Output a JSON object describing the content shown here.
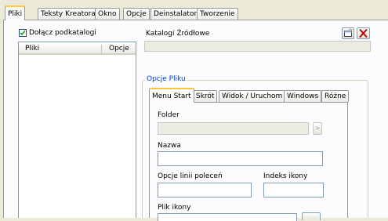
{
  "tabs": [
    "Pliki",
    "Teksty Kreatora",
    "Okno",
    "Opcje",
    "Deinstalator",
    "Tworzenie"
  ],
  "include_subfolders": {
    "label": "Dołącz podkatalogi",
    "checked": true
  },
  "file_list": {
    "columns": [
      "Pliki",
      "Opcje"
    ]
  },
  "source_folders_label": "Katalogi Źródłowe",
  "file_options": {
    "group_label": "Opcje Pliku",
    "tabs": [
      "Menu Start",
      "Skrót",
      "Widok / Uruchom",
      "Windows",
      "Różne"
    ],
    "fields": {
      "folder": "Folder",
      "name": "Nazwa",
      "cmdline": "Opcje linii poleceń",
      "icon_index": "Indeks ikony",
      "icon_file": "Plik ikony"
    },
    "browse_glyph": ">"
  },
  "colors": {
    "accent_tab": "#ffc83c",
    "group_label": "#0046d5",
    "delete_icon": "#c00000"
  }
}
